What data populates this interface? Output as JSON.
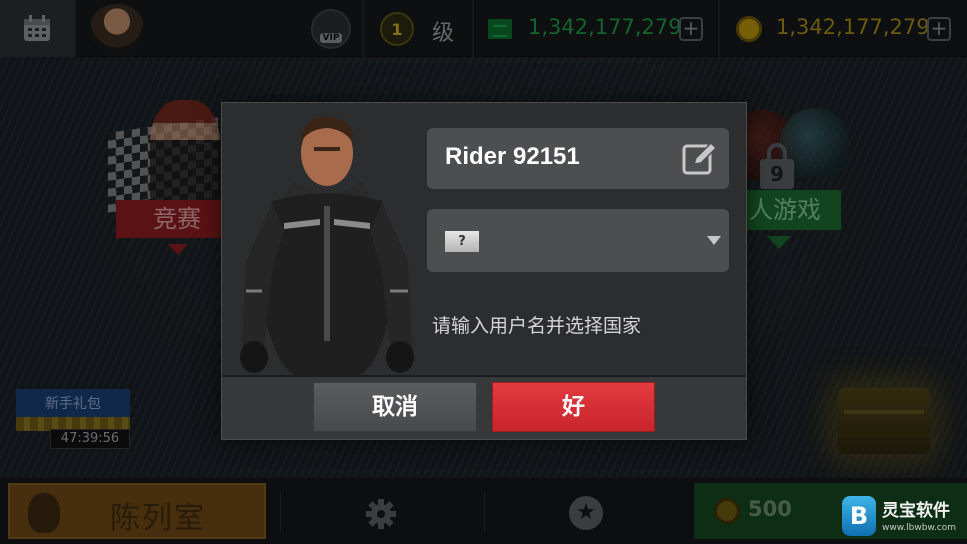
{
  "topbar": {
    "vip_label": "VIP",
    "level_value": "1",
    "level_label": "级",
    "tickets_value": "1,342,177,279",
    "coins_value": "1,342,177,279",
    "plus_symbol": "+"
  },
  "background": {
    "race_label": "竞赛",
    "multiplayer_label": "人游戏",
    "multiplayer_lock_level": "9",
    "gift_label": "新手礼包",
    "gift_timer": "47:39:56"
  },
  "bottombar": {
    "garage_label": "陈列室",
    "bonus_value": "500",
    "star_symbol": "★"
  },
  "dialog": {
    "name_value": "Rider 92151",
    "country_flag_placeholder": "?",
    "hint": "请输入用户名并选择国家",
    "cancel_label": "取消",
    "ok_label": "好"
  },
  "watermark": {
    "logo_letter": "B",
    "title": "灵宝软件",
    "url": "www.lbwbw.com"
  },
  "colors": {
    "ok_button": "#d6303a",
    "cancel_button": "#525456",
    "tickets_green": "#1a9a45",
    "coins_gold": "#a48b10",
    "dialog_bg": "#2b2d2f"
  }
}
